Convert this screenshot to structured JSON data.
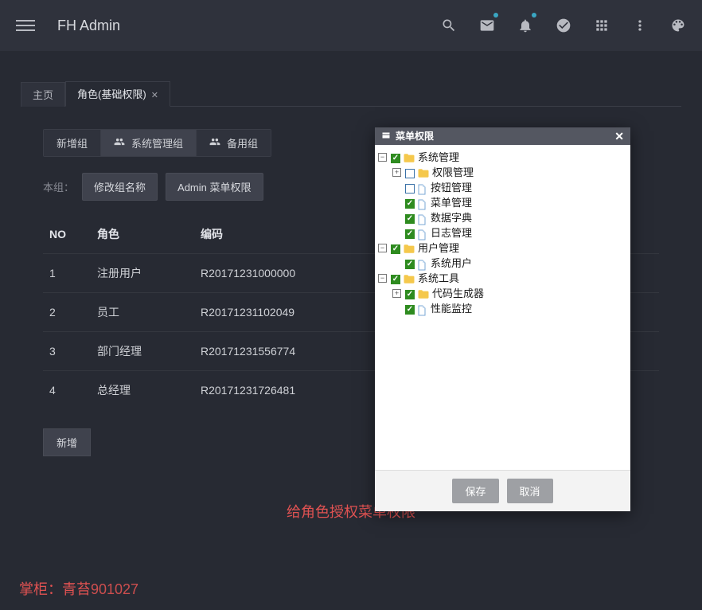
{
  "header": {
    "title": "FH Admin"
  },
  "tabs": [
    {
      "label": "主页",
      "active": false
    },
    {
      "label": "角色(基础权限)",
      "active": true,
      "closable": true
    }
  ],
  "group_tabs": {
    "items": [
      {
        "label": "新增组",
        "icon": null
      },
      {
        "label": "系统管理组",
        "icon": "users",
        "active": true
      },
      {
        "label": "备用组",
        "icon": "users"
      }
    ]
  },
  "subrow": {
    "prefix": "本组：",
    "rename_btn": "修改组名称",
    "perm_btn": "Admin 菜单权限"
  },
  "table": {
    "headers": [
      "NO",
      "角色",
      "编码"
    ],
    "rows": [
      {
        "no": "1",
        "role": "注册用户",
        "code": "R20171231000000"
      },
      {
        "no": "2",
        "role": "员工",
        "code": "R20171231102049"
      },
      {
        "no": "3",
        "role": "部门经理",
        "code": "R20171231556774"
      },
      {
        "no": "4",
        "role": "总经理",
        "code": "R20171231726481"
      }
    ],
    "add_btn": "新增"
  },
  "caption": "给角色授权菜单权限",
  "footer": {
    "label": "掌柜：",
    "name_prefix": "青苔",
    "id": "901027"
  },
  "modal": {
    "title": "菜单权限",
    "save": "保存",
    "cancel": "取消",
    "tree": [
      {
        "depth": 0,
        "expander": "minus",
        "checked": true,
        "type": "folder",
        "label": "系统管理"
      },
      {
        "depth": 1,
        "expander": "plus",
        "checked": false,
        "type": "folder",
        "label": "权限管理"
      },
      {
        "depth": 1,
        "expander": null,
        "checked": false,
        "type": "file",
        "label": "按钮管理"
      },
      {
        "depth": 1,
        "expander": null,
        "checked": true,
        "type": "file",
        "label": "菜单管理"
      },
      {
        "depth": 1,
        "expander": null,
        "checked": true,
        "type": "file",
        "label": "数据字典"
      },
      {
        "depth": 1,
        "expander": null,
        "checked": true,
        "type": "file",
        "label": "日志管理"
      },
      {
        "depth": 0,
        "expander": "minus",
        "checked": true,
        "type": "folder",
        "label": "用户管理"
      },
      {
        "depth": 1,
        "expander": null,
        "checked": true,
        "type": "file",
        "label": "系统用户"
      },
      {
        "depth": 0,
        "expander": "minus",
        "checked": true,
        "type": "folder",
        "label": "系统工具"
      },
      {
        "depth": 1,
        "expander": "plus",
        "checked": true,
        "type": "folder",
        "label": "代码生成器"
      },
      {
        "depth": 1,
        "expander": null,
        "checked": true,
        "type": "file",
        "label": "性能监控"
      }
    ]
  }
}
